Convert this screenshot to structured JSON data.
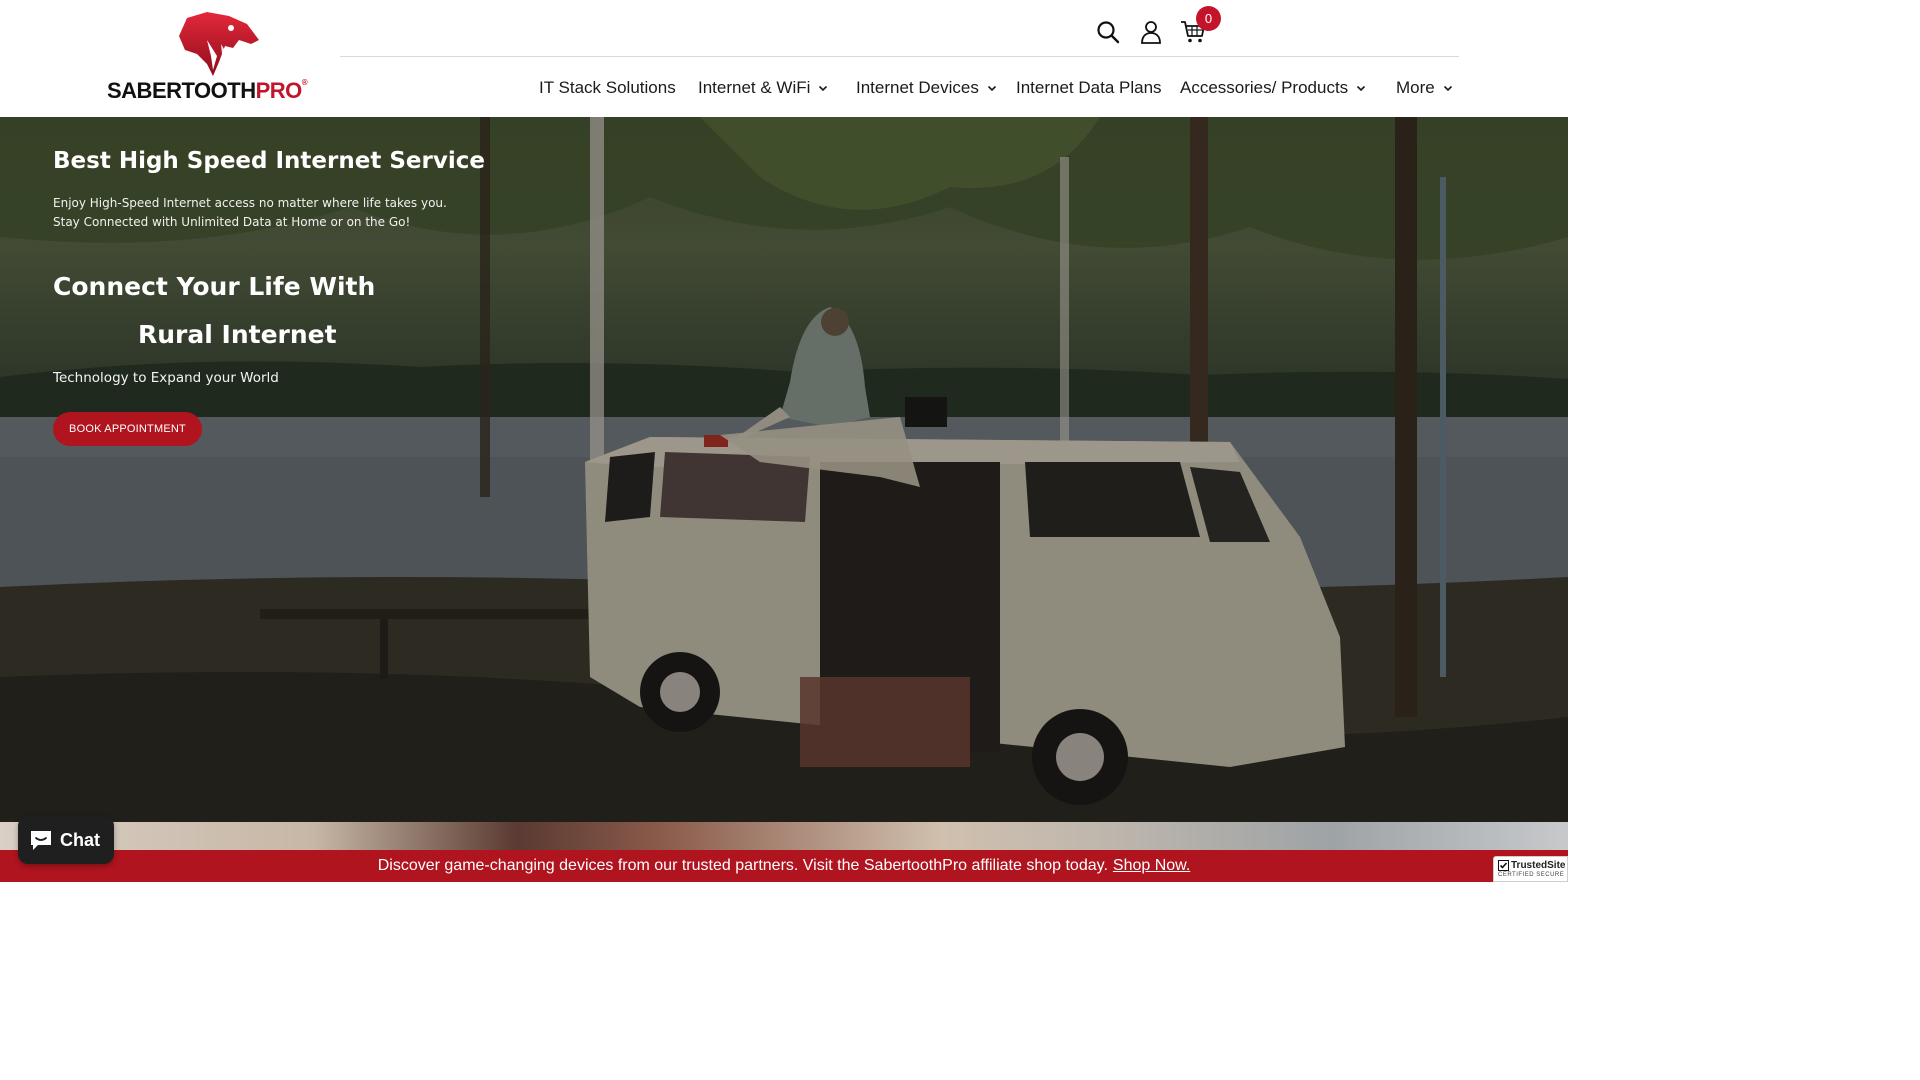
{
  "brand": {
    "name_main": "SABERTOOTH",
    "name_accent": "PRO",
    "registered": "®",
    "accent_color": "#c3142b"
  },
  "header": {
    "icons": [
      "search-icon",
      "account-icon",
      "cart-icon"
    ],
    "cart_count": "0"
  },
  "nav": {
    "items": [
      {
        "label": "IT Stack Solutions",
        "has_dropdown": false
      },
      {
        "label": "Internet & WiFi",
        "has_dropdown": true
      },
      {
        "label": "Internet Devices",
        "has_dropdown": true
      },
      {
        "label": "Internet Data Plans",
        "has_dropdown": false
      },
      {
        "label": "Accessories/ Products",
        "has_dropdown": true
      },
      {
        "label": "More",
        "has_dropdown": true
      }
    ]
  },
  "hero": {
    "title": "Best High Speed Internet Service",
    "subtitle_line1": "Enjoy High-Speed Internet access no matter where life takes you.",
    "subtitle_line2": "Stay Connected with Unlimited Data at Home or on the Go!",
    "heading_line1": "Connect Your Life With",
    "heading_line2": "Rural Internet",
    "tagline": "Technology to Expand your World",
    "cta_label": "BOOK APPOINTMENT",
    "cta_color": "#b0141f"
  },
  "announcement": {
    "text": "Discover game-changing devices from our trusted partners. Visit the SabertoothPro affiliate shop today.",
    "link_label": "Shop Now.",
    "background": "#b0141f"
  },
  "chat": {
    "label": "Chat"
  },
  "trust_badge": {
    "name": "TrustedSite",
    "sub": "CERTIFIED SECURE"
  }
}
